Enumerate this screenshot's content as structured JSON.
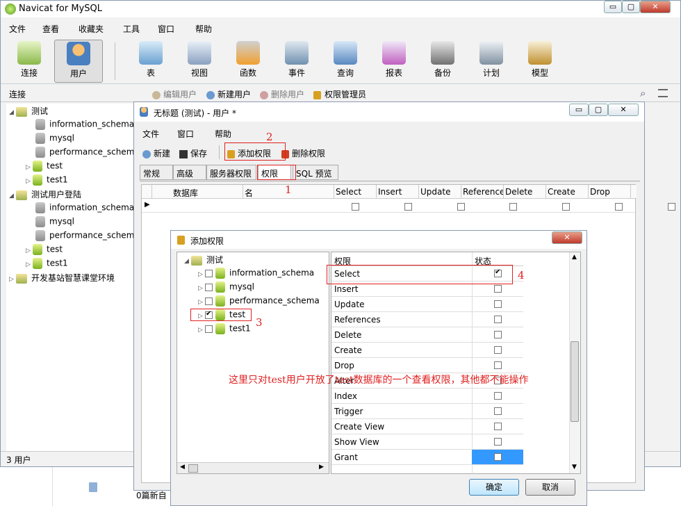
{
  "app": {
    "title": "Navicat for MySQL",
    "min": "▭",
    "max": "▢",
    "close": "✕"
  },
  "menu": [
    "文件",
    "查看",
    "收藏夹",
    "工具",
    "窗口",
    "帮助"
  ],
  "toolbar": [
    "连接",
    "用户",
    "表",
    "视图",
    "函数",
    "事件",
    "查询",
    "报表",
    "备份",
    "计划",
    "模型"
  ],
  "subbar": {
    "label": "连接",
    "edit": "编辑用户",
    "new": "新建用户",
    "delete": "删除用户",
    "priv": "权限管理员"
  },
  "tree": [
    {
      "label": "测试",
      "type": "conn",
      "children": [
        "information_schema",
        "mysql",
        "performance_schema",
        "test",
        "test1"
      ]
    },
    {
      "label": "测试用户登陆",
      "type": "conn",
      "children": [
        "information_schema",
        "mysql",
        "performance_schema",
        "test",
        "test1"
      ]
    },
    {
      "label": "开发基站智慧课堂环境",
      "type": "conn",
      "children": []
    }
  ],
  "status": "3 用户",
  "behind": {
    "text": "0篇新自"
  },
  "user_win": {
    "title": "无标题 (测试) - 用户 *",
    "menu": [
      "文件",
      "窗口",
      "帮助"
    ],
    "tools": {
      "new": "新建",
      "save": "保存",
      "add": "添加权限",
      "del": "删除权限"
    },
    "tabs": [
      "常规",
      "高级",
      "服务器权限",
      "权限",
      "SQL 预览"
    ],
    "grid_headers": [
      "数据库",
      "名",
      "Select",
      "Insert",
      "Update",
      "Reference",
      "Delete",
      "Create",
      "Drop"
    ]
  },
  "dialog": {
    "title": "添加权限",
    "tree_root": "测试",
    "dbs": [
      {
        "name": "information_schema",
        "checked": false
      },
      {
        "name": "mysql",
        "checked": false
      },
      {
        "name": "performance_schema",
        "checked": false
      },
      {
        "name": "test",
        "checked": true
      },
      {
        "name": "test1",
        "checked": false
      }
    ],
    "col_priv": "权限",
    "col_state": "状态",
    "privs": [
      {
        "name": "Select",
        "checked": true
      },
      {
        "name": "Insert",
        "checked": false
      },
      {
        "name": "Update",
        "checked": false
      },
      {
        "name": "References",
        "checked": false
      },
      {
        "name": "Delete",
        "checked": false
      },
      {
        "name": "Create",
        "checked": false
      },
      {
        "name": "Drop",
        "checked": false
      },
      {
        "name": "Alter",
        "checked": false
      },
      {
        "name": "Index",
        "checked": false
      },
      {
        "name": "Trigger",
        "checked": false
      },
      {
        "name": "Create View",
        "checked": false
      },
      {
        "name": "Show View",
        "checked": false
      },
      {
        "name": "Grant",
        "checked": false
      }
    ],
    "ok": "确定",
    "cancel": "取消"
  },
  "annotations": {
    "n1": "1",
    "n2": "2",
    "n3": "3",
    "n4": "4",
    "note": "这里只对test用户开放了test数据库的一个查看权限，其他都不能操作"
  },
  "colors": {
    "accent": "#3399ff",
    "red": "#e02020"
  }
}
